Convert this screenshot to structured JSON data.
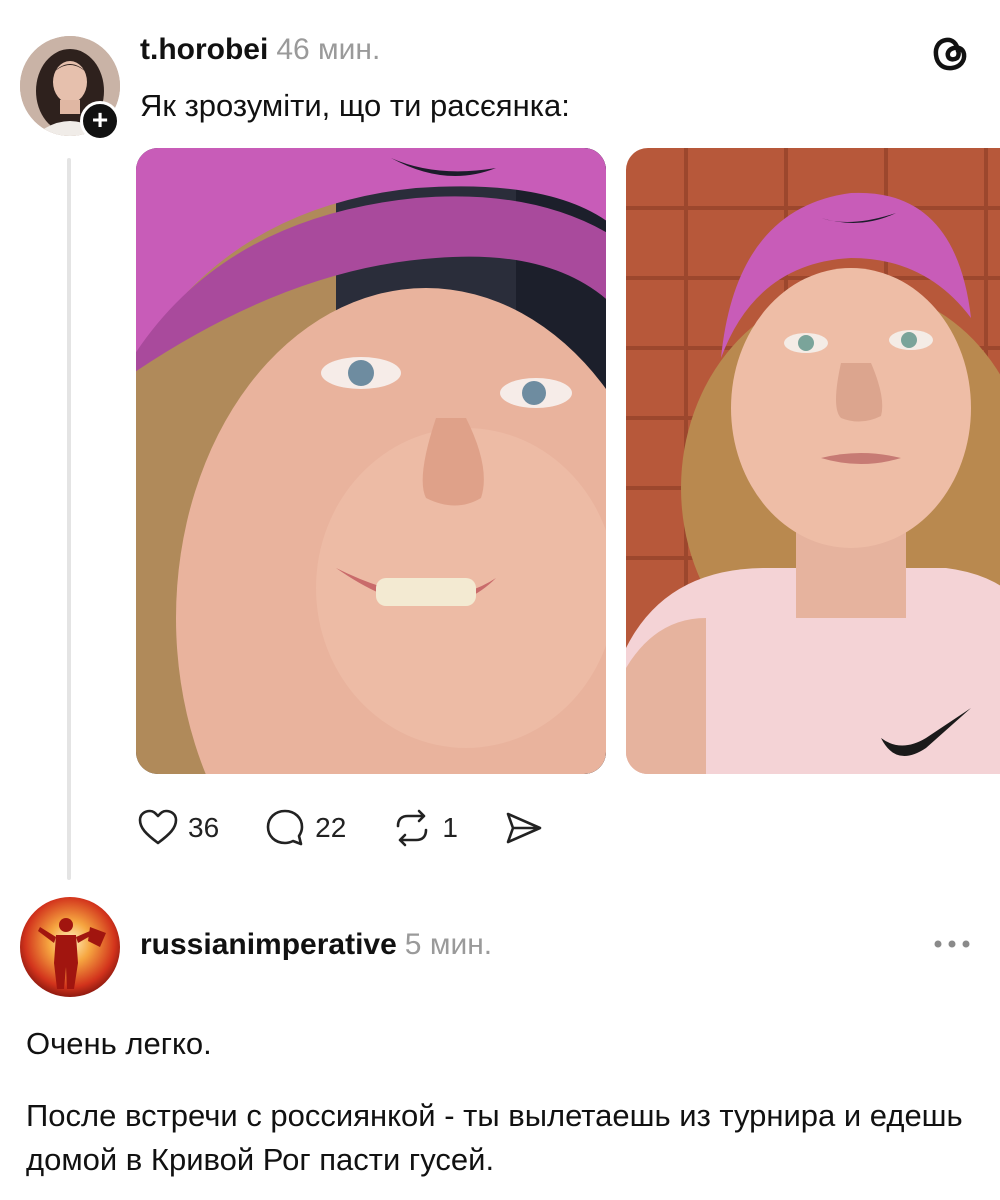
{
  "post": {
    "username": "t.horobei",
    "time": "46 мин.",
    "text": "Як зрозуміти, що ти расєянка:",
    "follow_symbol": "+",
    "images": [
      {
        "icon": "photo-player-smiling-pink-visor"
      },
      {
        "icon": "photo-player-pink-visor-brick-wall"
      }
    ],
    "actions": {
      "likes": "36",
      "comments": "22",
      "reposts": "1"
    }
  },
  "reply": {
    "username": "russianimperative",
    "time": "5 мин.",
    "paragraph1": "Очень легко.",
    "paragraph2": "После встречи с россиянкой - ты вылетаешь из турнира и едешь домой в Кривой Рог пасти гусей."
  },
  "colors": {
    "visor_pink": "#c85cb8",
    "brick": "#b7583a",
    "muted_text": "#9a9a9a"
  }
}
